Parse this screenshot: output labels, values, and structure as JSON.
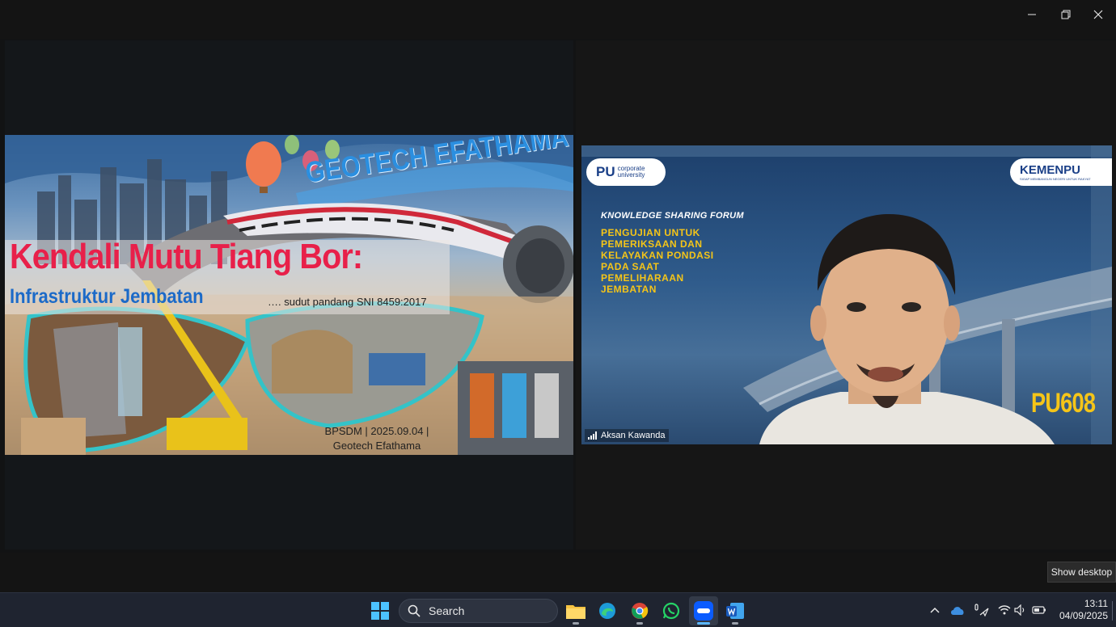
{
  "window": {
    "controls": {
      "minimize": "minimize-icon",
      "restore": "restore-icon",
      "close": "close-icon"
    }
  },
  "slide": {
    "brand": "GEOTECH EFATHAMA",
    "title": "Kendali Mutu Tiang Bor:",
    "subtitle": "Infrastruktur Jembatan",
    "tagline": "…. sudut pandang SNI 8459:2017",
    "footer_line1": "BPSDM | 2025.09.04 |",
    "footer_line2": "Geotech Efathama"
  },
  "video": {
    "logo_left_main": "PU",
    "logo_left_sub": "corporate university",
    "logo_right_main": "KEMENPU",
    "logo_right_sub": "SIGAP MEMBANGUN NEGERI UNTUK RAKYAT",
    "forum": "KNOWLEDGE SHARING FORUM",
    "topic_lines": [
      "PENGUJIAN UNTUK",
      "PEMERIKSAAN DAN",
      "KELAYAKAN PONDASI",
      "PADA SAAT",
      "PEMELIHARAAN",
      "JEMBATAN"
    ],
    "badge": "PU608",
    "participant_name": "Aksan Kawanda"
  },
  "tooltip": {
    "text": "Show desktop"
  },
  "taskbar": {
    "search_placeholder": "Search",
    "apps": [
      "windows-start",
      "file-explorer",
      "edge",
      "chrome",
      "whatsapp",
      "zoom",
      "word"
    ],
    "active_app": "zoom",
    "time": "13:11",
    "date": "04/09/2025"
  },
  "colors": {
    "title_red": "#e8204a",
    "subtitle_blue": "#1c6ac8",
    "topic_yellow": "#f5c518",
    "taskbar": "#1f2430"
  }
}
